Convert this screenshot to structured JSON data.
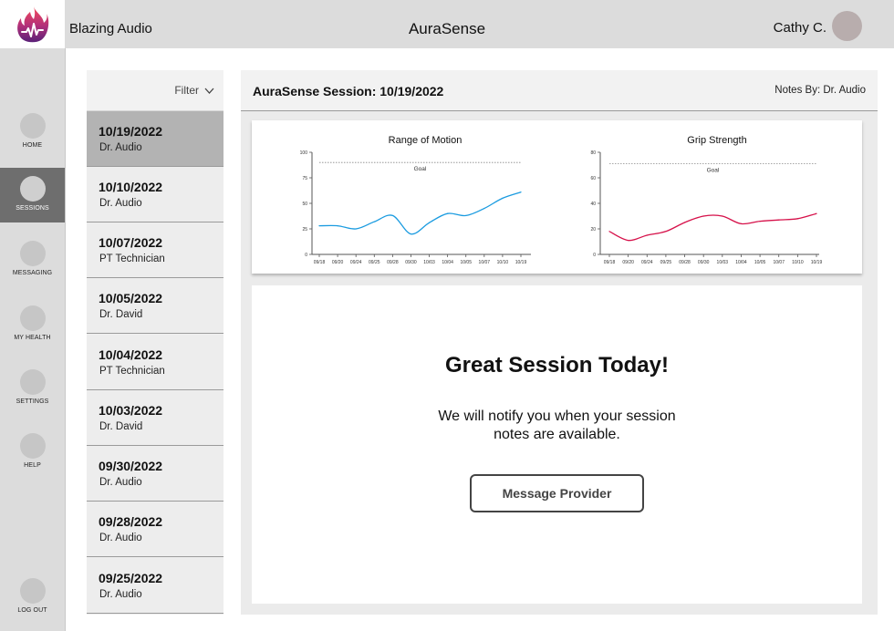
{
  "header": {
    "company": "Blazing Audio",
    "app_title": "AuraSense",
    "user_name": "Cathy C.",
    "logo_icon": "flame-pulse-icon",
    "logo_colors": [
      "#f54a5a",
      "#8b2a8f",
      "#5a2178"
    ]
  },
  "nav": {
    "items": [
      {
        "label": "HOME",
        "icon": "home-icon"
      },
      {
        "label": "SESSIONS",
        "icon": "sessions-icon",
        "active": true
      },
      {
        "label": "MESSAGING",
        "icon": "messaging-icon"
      },
      {
        "label": "MY HEALTH",
        "icon": "health-icon"
      },
      {
        "label": "SETTINGS",
        "icon": "settings-icon"
      },
      {
        "label": "HELP",
        "icon": "help-icon"
      }
    ],
    "logout": "LOG OUT"
  },
  "sessions": {
    "filter_label": "Filter",
    "items": [
      {
        "date": "10/19/2022",
        "provider": "Dr. Audio",
        "selected": true
      },
      {
        "date": "10/10/2022",
        "provider": "Dr. Audio"
      },
      {
        "date": "10/07/2022",
        "provider": "PT Technician"
      },
      {
        "date": "10/05/2022",
        "provider": "Dr. David"
      },
      {
        "date": "10/04/2022",
        "provider": "PT Technician"
      },
      {
        "date": "10/03/2022",
        "provider": "Dr. David"
      },
      {
        "date": "09/30/2022",
        "provider": "Dr. Audio"
      },
      {
        "date": "09/28/2022",
        "provider": "Dr. Audio"
      },
      {
        "date": "09/25/2022",
        "provider": "Dr. Audio"
      }
    ]
  },
  "main": {
    "title": "AuraSense Session: 10/19/2022",
    "notes_by": "Notes By: Dr. Audio",
    "message": {
      "heading": "Great Session Today!",
      "body": "We will notify you when your session notes are available.",
      "button_label": "Message Provider"
    }
  },
  "chart_data": [
    {
      "type": "line",
      "title": "Range of Motion",
      "x": [
        "09/18",
        "09/20",
        "09/24",
        "09/25",
        "09/28",
        "09/30",
        "10/03",
        "10/04",
        "10/05",
        "10/07",
        "10/10",
        "10/19"
      ],
      "series": [
        {
          "values": [
            28,
            28,
            25,
            32,
            38,
            20,
            31,
            40,
            38,
            45,
            55,
            61
          ],
          "color": "#1a9be0"
        }
      ],
      "goal": {
        "value": 90,
        "label": "Goal"
      },
      "ylim": [
        0,
        100
      ],
      "yticks": [
        0,
        25,
        50,
        75,
        100
      ],
      "grid": false
    },
    {
      "type": "line",
      "title": "Grip Strength",
      "x": [
        "09/18",
        "09/20",
        "09/24",
        "09/25",
        "09/28",
        "09/30",
        "10/03",
        "10/04",
        "10/05",
        "10/07",
        "10/10",
        "10/19"
      ],
      "series": [
        {
          "values": [
            18,
            11,
            15,
            18,
            25,
            30,
            30,
            24,
            26,
            27,
            28,
            32
          ],
          "color": "#d6114a"
        }
      ],
      "goal": {
        "value": 71,
        "label": "Goal"
      },
      "ylim": [
        0,
        80
      ],
      "yticks": [
        0,
        20,
        40,
        60,
        80
      ],
      "grid": false
    }
  ]
}
